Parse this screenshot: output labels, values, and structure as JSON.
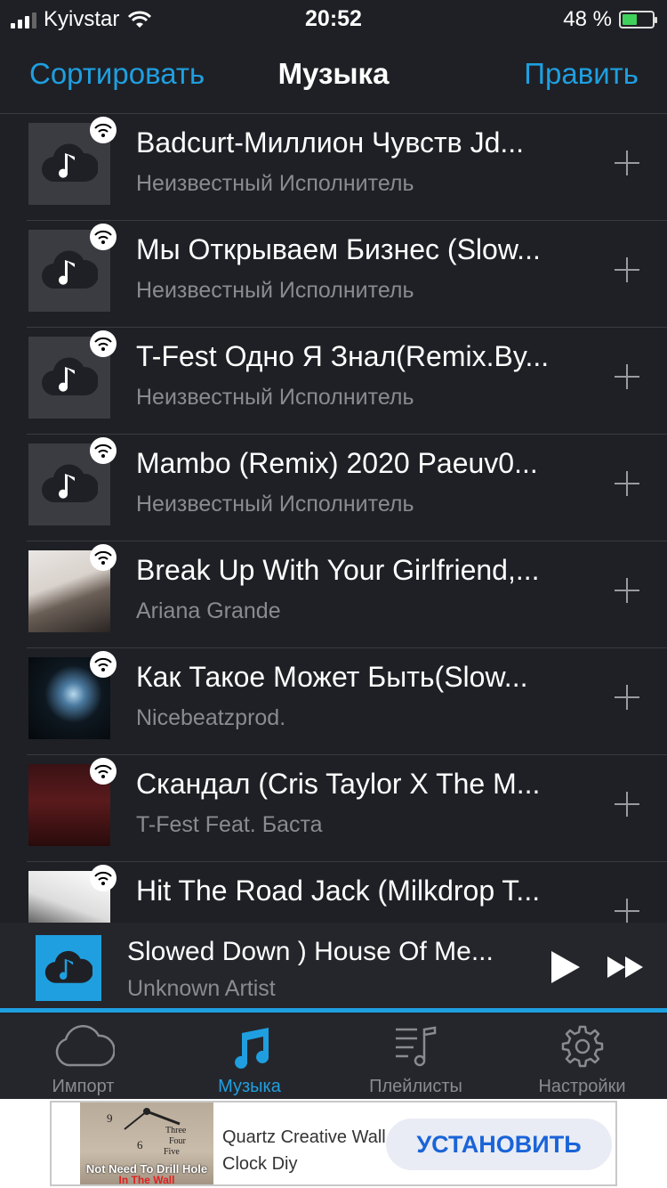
{
  "status_bar": {
    "carrier": "Kyivstar",
    "time": "20:52",
    "battery_percent": "48 %",
    "battery_level": 0.48
  },
  "nav": {
    "left_button": "Сортировать",
    "title": "Музыка",
    "right_button": "Править"
  },
  "tracks": [
    {
      "title": "Badcurt-Миллион Чувств Jd...",
      "artist": "Неизвестный Исполнитель",
      "artwork": "cloud-music-icon"
    },
    {
      "title": "Мы Открываем Бизнес (Slow...",
      "artist": "Неизвестный Исполнитель",
      "artwork": "cloud-music-icon"
    },
    {
      "title": "T-Fest Одно Я Знал(Remix.By...",
      "artist": "Неизвестный Исполнитель",
      "artwork": "cloud-music-icon"
    },
    {
      "title": "Mambo (Remix) 2020 Paeuv0...",
      "artist": "Неизвестный Исполнитель",
      "artwork": "cloud-music-icon"
    },
    {
      "title": "Break Up With Your Girlfriend,...",
      "artist": "Ariana Grande",
      "artwork": "album-art"
    },
    {
      "title": "Как Такое Может Быть(Slow...",
      "artist": "Nicebeatzprod.",
      "artwork": "album-art"
    },
    {
      "title": "Скандал (Cris Taylor X The M...",
      "artist": "T-Fest Feat. Баста",
      "artwork": "album-art"
    },
    {
      "title": "Hit The Road Jack (Milkdrop T...",
      "artist": "",
      "artwork": "album-art"
    }
  ],
  "now_playing": {
    "title": "Slowed Down ) House Of Me...",
    "artist": "Unknown Artist",
    "play_icon": "play-icon",
    "next_icon": "fast-forward-icon"
  },
  "tabs": [
    {
      "label": "Импорт",
      "icon": "cloud-icon",
      "active": false
    },
    {
      "label": "Музыка",
      "icon": "music-note-icon",
      "active": true
    },
    {
      "label": "Плейлисты",
      "icon": "playlist-icon",
      "active": false
    },
    {
      "label": "Настройки",
      "icon": "gear-icon",
      "active": false
    }
  ],
  "ad": {
    "image_caption": "Not Need To Drill Hole",
    "image_caption_2": "In The Wall",
    "text": "Quartz Creative Wall Clock Diy",
    "cta": "УСТАНОВИТЬ"
  },
  "colors": {
    "accent": "#1f9fe0",
    "background": "#1f2025",
    "secondary_text": "#8a8b90"
  }
}
